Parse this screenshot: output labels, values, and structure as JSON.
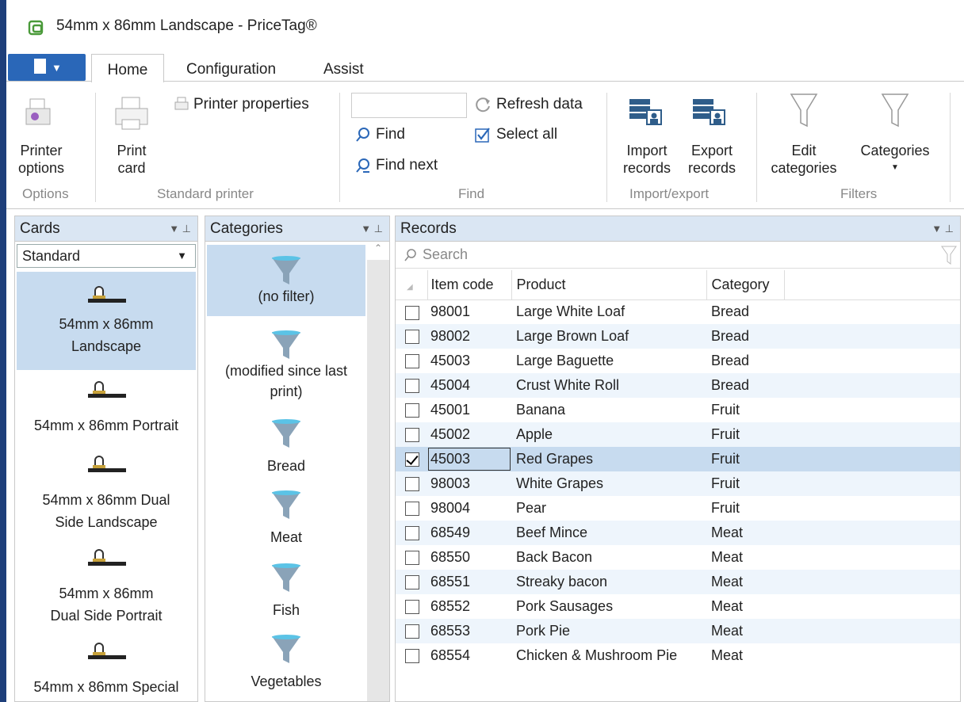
{
  "window": {
    "title": "54mm x 86mm Landscape - PriceTag®"
  },
  "tabs": [
    {
      "label": "Home"
    },
    {
      "label": "Configuration"
    },
    {
      "label": "Assist"
    }
  ],
  "ribbon": {
    "printer_options": "Printer\noptions",
    "print_card": "Print\ncard",
    "printer_properties": "Printer properties",
    "find": "Find",
    "find_next": "Find next",
    "find_value": "",
    "refresh": "Refresh data",
    "select_all": "Select all",
    "import_records": "Import\nrecords",
    "export_records": "Export\nrecords",
    "edit_categories": "Edit\ncategories",
    "categories": "Categories",
    "groups": {
      "options": "Options",
      "standard_printer": "Standard printer",
      "find": "Find",
      "import_export": "Import/export",
      "filters": "Filters"
    }
  },
  "cards_panel": {
    "title": "Cards",
    "combo_value": "Standard",
    "items": [
      {
        "label": "54mm x 86mm Landscape",
        "selected": true
      },
      {
        "label": "54mm x 86mm Portrait"
      },
      {
        "label": "54mm x 86mm Dual Side Landscape"
      },
      {
        "label": "54mm x 86mm Dual Side Portrait"
      },
      {
        "label": "54mm x 86mm Special"
      }
    ]
  },
  "categories_panel": {
    "title": "Categories",
    "items": [
      {
        "label": "(no filter)",
        "selected": true
      },
      {
        "label": "(modified since last print)"
      },
      {
        "label": "Bread"
      },
      {
        "label": "Meat"
      },
      {
        "label": "Fish"
      },
      {
        "label": "Vegetables"
      }
    ]
  },
  "records_panel": {
    "title": "Records",
    "search_placeholder": "Search",
    "columns": [
      "Item code",
      "Product",
      "Category"
    ],
    "rows": [
      {
        "code": "98001",
        "product": "Large White Loaf",
        "category": "Bread"
      },
      {
        "code": "98002",
        "product": "Large Brown Loaf",
        "category": "Bread"
      },
      {
        "code": "45003",
        "product": "Large Baguette",
        "category": "Bread"
      },
      {
        "code": "45004",
        "product": "Crust White Roll",
        "category": "Bread"
      },
      {
        "code": "45001",
        "product": "Banana",
        "category": "Fruit"
      },
      {
        "code": "45002",
        "product": "Apple",
        "category": "Fruit"
      },
      {
        "code": "45003",
        "product": "Red Grapes",
        "category": "Fruit",
        "checked": true,
        "current": true
      },
      {
        "code": "98003",
        "product": "White Grapes",
        "category": "Fruit"
      },
      {
        "code": "98004",
        "product": "Pear",
        "category": "Fruit"
      },
      {
        "code": "68549",
        "product": "Beef Mince",
        "category": "Meat"
      },
      {
        "code": "68550",
        "product": "Back Bacon",
        "category": "Meat"
      },
      {
        "code": "68551",
        "product": "Streaky bacon",
        "category": "Meat"
      },
      {
        "code": "68552",
        "product": "Pork Sausages",
        "category": "Meat"
      },
      {
        "code": "68553",
        "product": "Pork Pie",
        "category": "Meat"
      },
      {
        "code": "68554",
        "product": "Chicken & Mushroom Pie",
        "category": "Meat"
      }
    ]
  }
}
